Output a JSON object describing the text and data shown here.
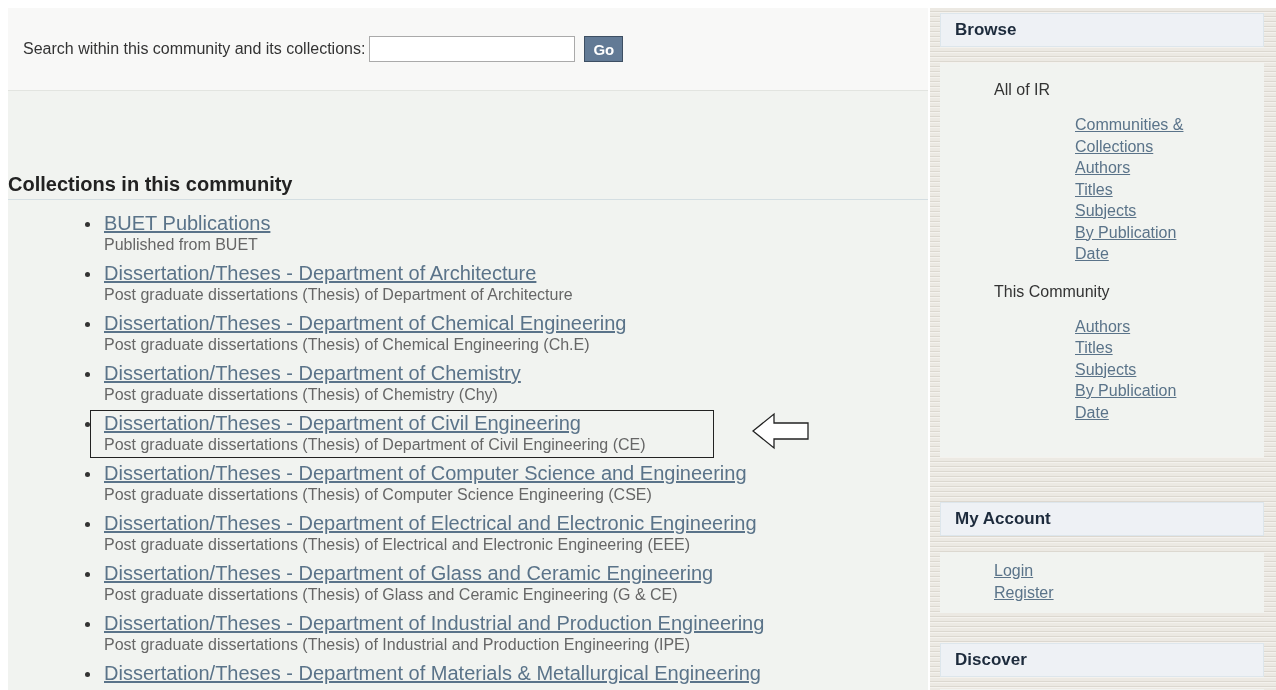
{
  "search": {
    "label": "Search within this community and its collections:",
    "button": "Go"
  },
  "collections": {
    "heading": "Collections in this community",
    "items": [
      {
        "title": "BUET Publications",
        "description": "Published from BUET",
        "highlighted": false
      },
      {
        "title": "Dissertation/Theses - Department of Architecture",
        "description": "Post graduate dissertations (Thesis) of Department of Architecture",
        "highlighted": false
      },
      {
        "title": "Dissertation/Theses - Department of Chemical Engineering",
        "description": "Post graduate dissertations (Thesis) of Chemical Engineering (Ch.E)",
        "highlighted": false
      },
      {
        "title": "Dissertation/Theses - Department of Chemistry",
        "description": "Post graduate dissertations (Thesis) of Chemistry (Chy)",
        "highlighted": false
      },
      {
        "title": "Dissertation/Theses - Department of Civil Engineering",
        "description": "Post graduate dissertations (Thesis) of Department of Civil Engineering (CE)",
        "highlighted": true
      },
      {
        "title": "Dissertation/Theses - Department of Computer Science and Engineering",
        "description": "Post graduate dissertations (Thesis) of Computer Science Engineering (CSE)",
        "highlighted": false
      },
      {
        "title": "Dissertation/Theses - Department of Electrical and Electronic Engineering",
        "description": "Post graduate dissertations (Thesis) of Electrical and Electronic Engineering (EEE)",
        "highlighted": false
      },
      {
        "title": "Dissertation/Theses - Department of Glass and Ceramic Engineering",
        "description": "Post graduate dissertations (Thesis) of Glass and Ceramic Engineering (G & CE)",
        "highlighted": false
      },
      {
        "title": "Dissertation/Theses - Department of Industrial and Production Engineering",
        "description": "Post graduate dissertations (Thesis) of Industrial and Production Engineering (IPE)",
        "highlighted": false
      },
      {
        "title": "Dissertation/Theses - Department of Materials & Metallurgical Engineering",
        "highlighted": false
      }
    ]
  },
  "sidebar": [
    {
      "title": "Browse",
      "groups": [
        {
          "label": "All of IR",
          "links": [
            "Communities & Collections",
            "Authors",
            "Titles",
            "Subjects",
            "By Publication Date"
          ]
        },
        {
          "label": "This Community",
          "links": [
            "Authors",
            "Titles",
            "Subjects",
            "By Publication Date"
          ]
        }
      ]
    },
    {
      "title": "My Account",
      "links": [
        "Login",
        "Register"
      ]
    },
    {
      "title": "Discover"
    }
  ]
}
